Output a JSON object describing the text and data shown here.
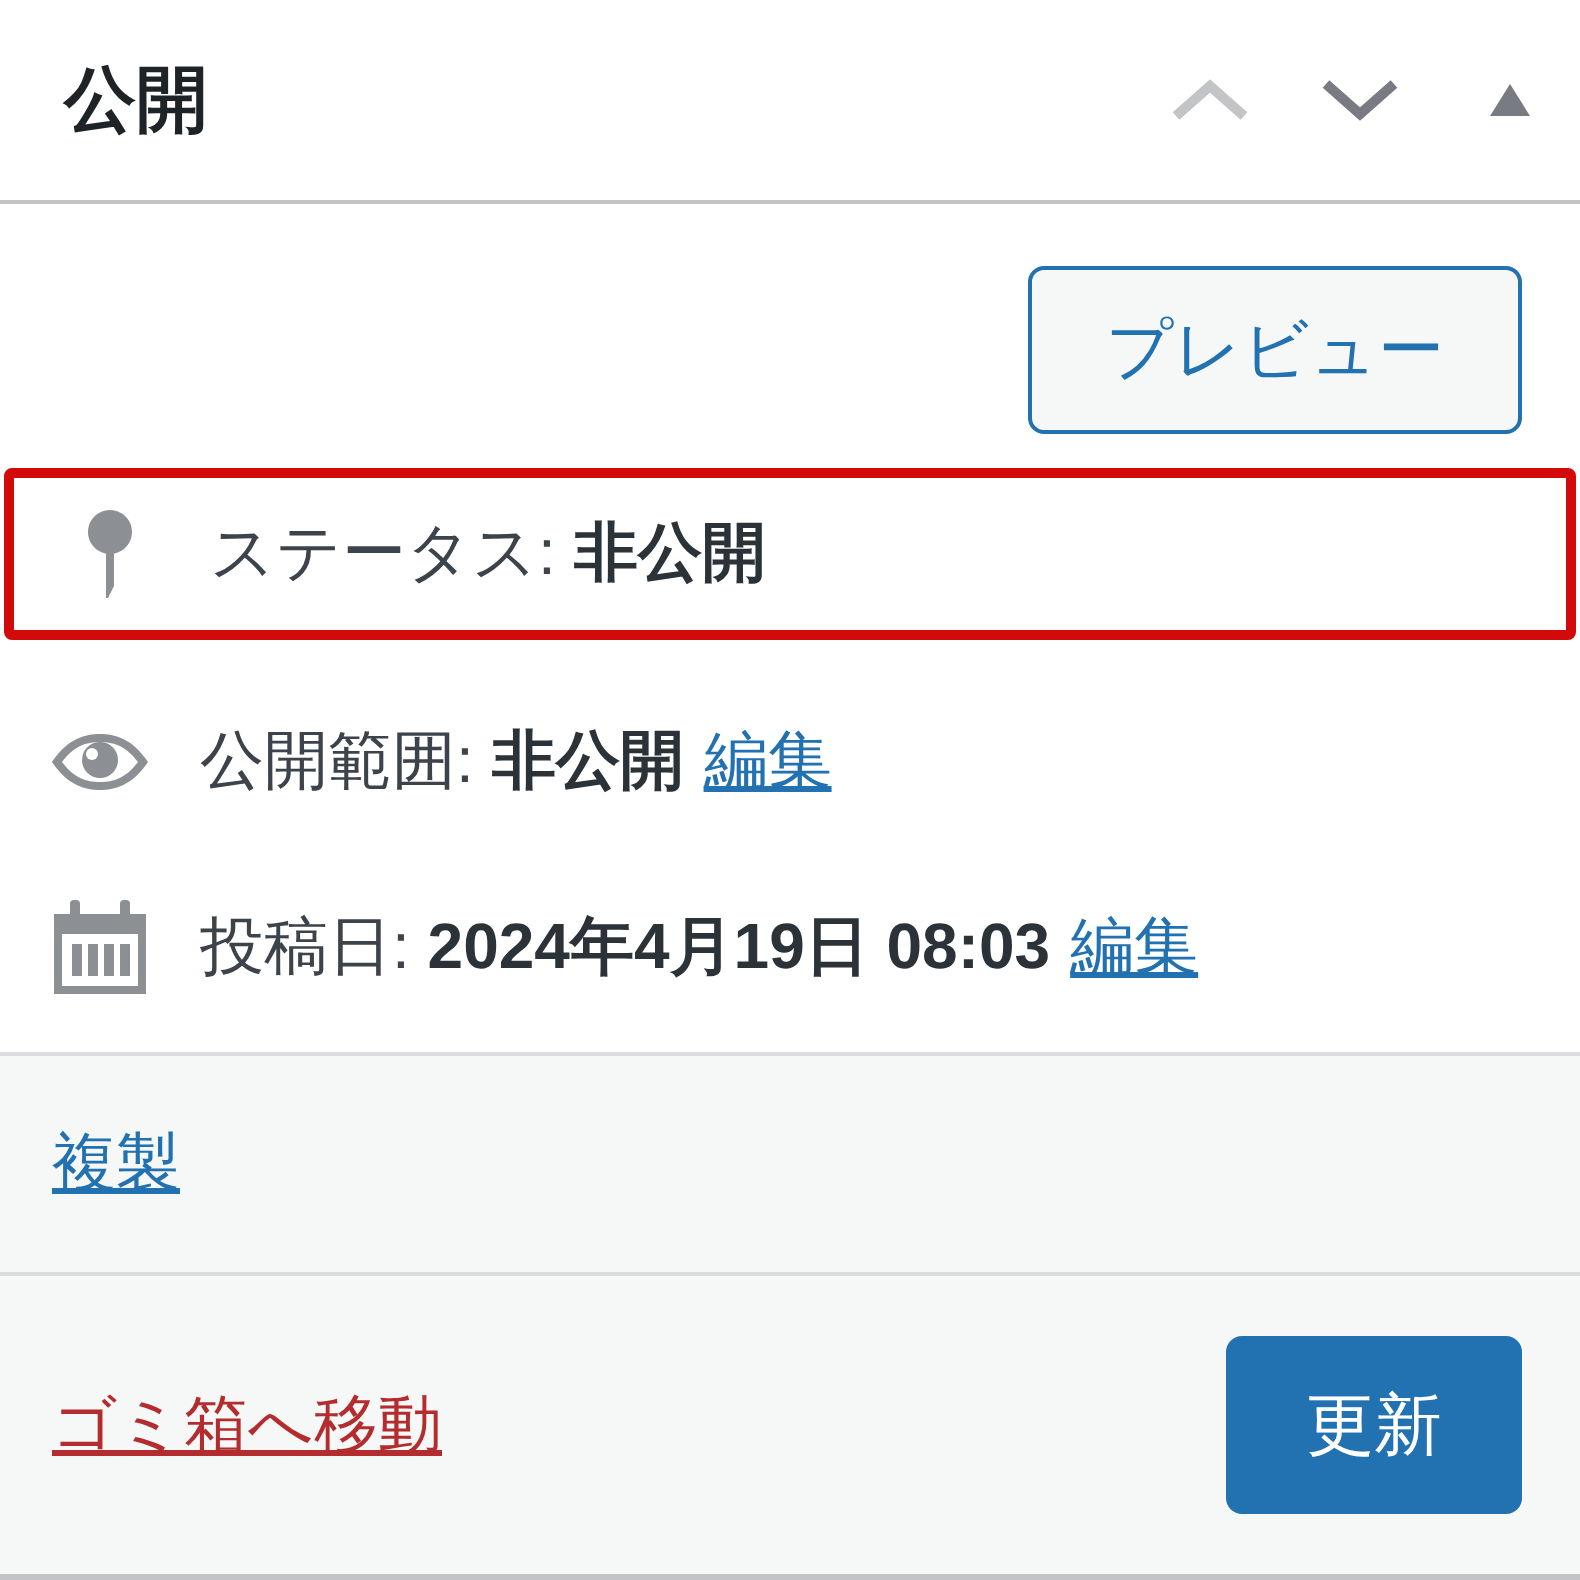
{
  "panel": {
    "title": "公開",
    "controls": [
      {
        "kind": "move-up",
        "disabled": true
      },
      {
        "kind": "move-down",
        "disabled": false
      },
      {
        "kind": "toggle",
        "expanded": true
      }
    ]
  },
  "preview_button": "プレビュー",
  "rows": [
    {
      "kind": "status",
      "label": "ステータス:",
      "value": "非公開",
      "highlighted": true
    },
    {
      "kind": "visibility",
      "label": "公開範囲:",
      "value": "非公開",
      "link": "編集",
      "highlighted": false
    },
    {
      "kind": "date",
      "label": "投稿日:",
      "value": "2024年4月19日 08:03",
      "link": "編集",
      "highlighted": false
    }
  ],
  "duplicate_link": "複製",
  "footer": {
    "trash_link": "ゴミ箱へ移動",
    "update_button": "更新"
  }
}
